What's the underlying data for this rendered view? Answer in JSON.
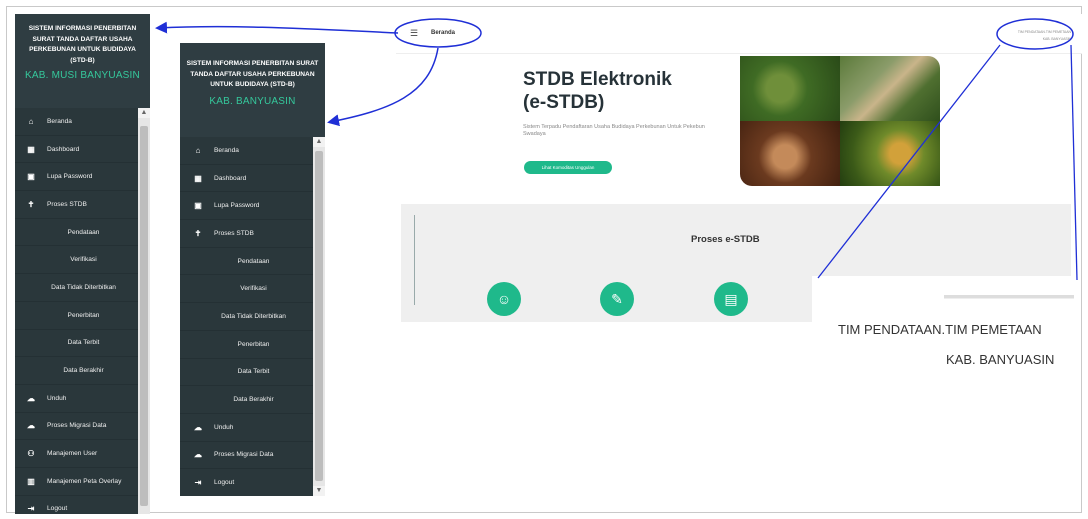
{
  "app_header": {
    "title": "SISTEM INFORMASI PENERBITAN SURAT TANDA DAFTAR USAHA PERKEBUNAN UNTUK BUDIDAYA (STD-B)",
    "region_a": "KAB. MUSI BANYUASIN",
    "region_b": "KAB. BANYUASIN"
  },
  "sidebar_a": [
    {
      "label": "Beranda",
      "icon": "home-icon",
      "sub": false
    },
    {
      "label": "Dashboard",
      "icon": "dashboard-icon",
      "sub": false
    },
    {
      "label": "Lupa Password",
      "icon": "lock-icon",
      "sub": false
    },
    {
      "label": "Proses STDB",
      "icon": "person-icon",
      "sub": false
    },
    {
      "label": "Pendataan",
      "sub": true
    },
    {
      "label": "Verifikasi",
      "sub": true
    },
    {
      "label": "Data Tidak Diterbitkan",
      "sub": true
    },
    {
      "label": "Penerbitan",
      "sub": true
    },
    {
      "label": "Data Terbit",
      "sub": true
    },
    {
      "label": "Data Berakhir",
      "sub": true
    },
    {
      "label": "Unduh",
      "icon": "cloud-icon",
      "sub": false
    },
    {
      "label": "Proses Migrasi Data",
      "icon": "cloud-icon",
      "sub": false
    },
    {
      "label": "Manajemen User",
      "icon": "users-icon",
      "sub": false
    },
    {
      "label": "Manajemen Peta Overlay",
      "icon": "map-icon",
      "sub": false
    },
    {
      "label": "Logout",
      "icon": "logout-icon",
      "sub": false
    }
  ],
  "sidebar_b": [
    {
      "label": "Beranda",
      "icon": "home-icon",
      "sub": false
    },
    {
      "label": "Dashboard",
      "icon": "dashboard-icon",
      "sub": false
    },
    {
      "label": "Lupa Password",
      "icon": "lock-icon",
      "sub": false
    },
    {
      "label": "Proses STDB",
      "icon": "person-icon",
      "sub": false
    },
    {
      "label": "Pendataan",
      "sub": true
    },
    {
      "label": "Verifikasi",
      "sub": true
    },
    {
      "label": "Data Tidak Diterbitkan",
      "sub": true
    },
    {
      "label": "Penerbitan",
      "sub": true
    },
    {
      "label": "Data Terbit",
      "sub": true
    },
    {
      "label": "Data Berakhir",
      "sub": true
    },
    {
      "label": "Unduh",
      "icon": "cloud-icon",
      "sub": false
    },
    {
      "label": "Proses Migrasi Data",
      "icon": "cloud-icon",
      "sub": false
    },
    {
      "label": "Logout",
      "icon": "logout-icon",
      "sub": false
    }
  ],
  "topbar": {
    "breadcrumb": "Beranda",
    "user_role": "TIM PENDATAAN.TIM PEMETAAN",
    "user_kab": "KAB. BANYUASIN"
  },
  "hero": {
    "title_line1": "STDB Elektronik",
    "title_line2": "(e-STDB)",
    "description": "Sistem Terpadu Pendaftaran Usaha Budidaya Perkebunan Untuk Pekebun Swadaya",
    "button": "Lihat Komoditas Unggulan"
  },
  "proses": {
    "title": "Proses e-STDB"
  },
  "zoom": {
    "role": "TIM PENDATAAN.TIM PEMETAAN",
    "kab": "KAB. BANYUASIN"
  },
  "colors": {
    "sidebar_bg": "#2f3d42",
    "accent_green": "#1fb98b",
    "region_green": "#35c89c",
    "annotation_blue": "#1f2fd6"
  }
}
